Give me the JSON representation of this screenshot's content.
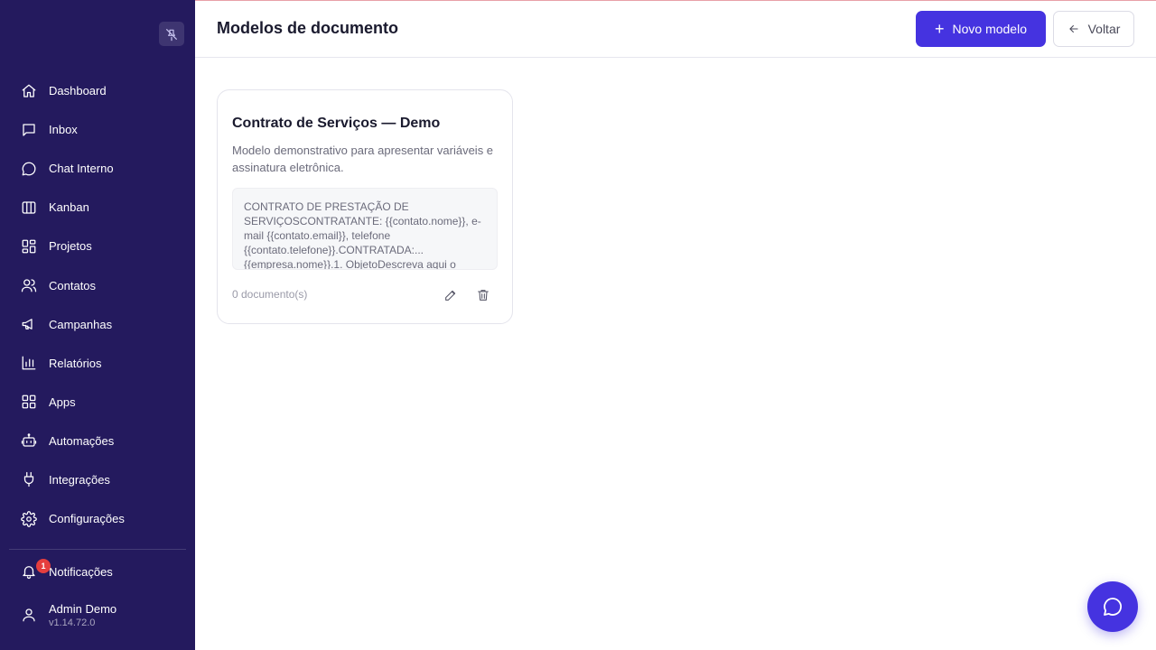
{
  "sidebar": {
    "pin_icon": "unpin-icon",
    "items": [
      {
        "label": "Dashboard",
        "icon": "home-icon"
      },
      {
        "label": "Inbox",
        "icon": "inbox-icon"
      },
      {
        "label": "Chat Interno",
        "icon": "chat-icon"
      },
      {
        "label": "Kanban",
        "icon": "kanban-icon"
      },
      {
        "label": "Projetos",
        "icon": "projects-icon"
      },
      {
        "label": "Contatos",
        "icon": "contacts-icon"
      },
      {
        "label": "Campanhas",
        "icon": "megaphone-icon"
      },
      {
        "label": "Relatórios",
        "icon": "bar-chart-icon"
      },
      {
        "label": "Apps",
        "icon": "apps-icon"
      },
      {
        "label": "Automações",
        "icon": "bot-icon"
      },
      {
        "label": "Integrações",
        "icon": "plug-icon"
      },
      {
        "label": "Configurações",
        "icon": "gear-icon"
      }
    ],
    "notifications": {
      "label": "Notificações",
      "badge": "1"
    },
    "user": {
      "name": "Admin Demo",
      "version": "v1.14.72.0"
    }
  },
  "header": {
    "title": "Modelos de documento",
    "new_button_label": "Novo modelo",
    "back_button_label": "Voltar"
  },
  "templates": [
    {
      "title": "Contrato de Serviços — Demo",
      "description": "Modelo demonstrativo para apresentar variáveis e assinatura eletrônica.",
      "preview": "CONTRATO DE PRESTAÇÃO DE SERVIÇOSCONTRATANTE: {{contato.nome}}, e-mail {{contato.email}}, telefone {{contato.telefone}}.CONTRATADA:... {{empresa.nome}}.1. ObjetoDescreva aqui o",
      "count": "0 documento(s)"
    }
  ],
  "colors": {
    "sidebar_bg": "#241a5e",
    "accent": "#4533e0",
    "badge": "#e53e3e"
  }
}
